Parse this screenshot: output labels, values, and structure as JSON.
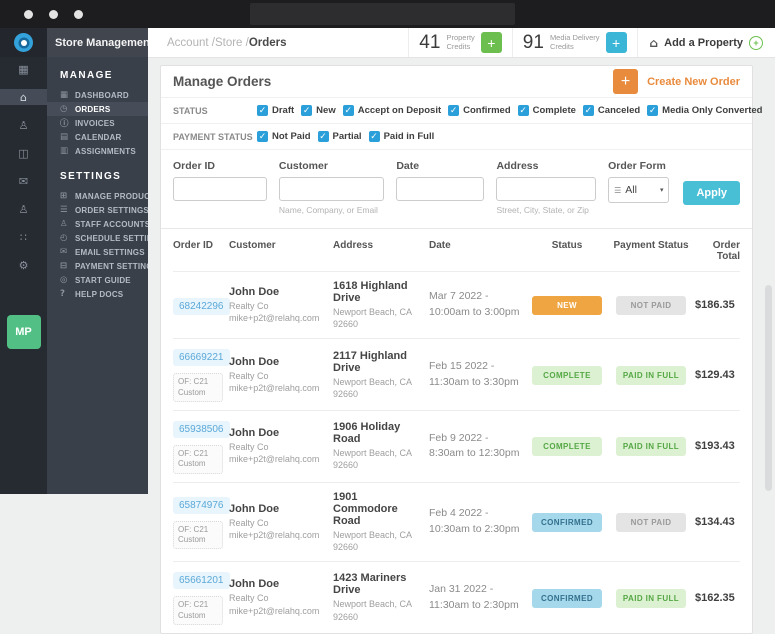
{
  "colors": {
    "accent_orange": "#e98b3d",
    "checkbox_blue": "#2b9fd9",
    "apply_teal": "#49bfd6",
    "credit_green": "#6cbf4e",
    "credit_blue": "#3bb6d6",
    "badge_new_orange": "#efa642",
    "badge_green_bg": "#dcf1d2",
    "badge_green_text": "#55a845",
    "badge_blue_bg": "#a6d8eb",
    "badge_gray_bg": "#e4e4e4",
    "avatar_green": "#52c085",
    "sidebar_dark": "#3a404a"
  },
  "sidebar": {
    "app_title": "Store Management",
    "avatar": "MP",
    "rail": [
      {
        "icon": "grid-icon",
        "glyph": "▦"
      },
      {
        "icon": "home-icon",
        "glyph": "⌂",
        "state": "active"
      },
      {
        "icon": "user-icon",
        "glyph": "♙"
      },
      {
        "icon": "store-icon",
        "glyph": "◫"
      },
      {
        "icon": "mail-icon",
        "glyph": "✉"
      },
      {
        "icon": "staff-icon",
        "glyph": "♙"
      },
      {
        "icon": "apps-icon",
        "glyph": "∷"
      },
      {
        "icon": "gear-icon",
        "glyph": "⚙"
      }
    ],
    "manage": {
      "heading": "MANAGE",
      "items": [
        {
          "label": "DASHBOARD",
          "icon": "dashboard-icon",
          "glyph": "▦"
        },
        {
          "label": "ORDERS",
          "icon": "orders-icon",
          "glyph": "◷",
          "state": "active"
        },
        {
          "label": "INVOICES",
          "icon": "invoices-icon",
          "glyph": "ⓘ"
        },
        {
          "label": "CALENDAR",
          "icon": "calendar-icon",
          "glyph": "▤"
        },
        {
          "label": "ASSIGNMENTS",
          "icon": "assignments-icon",
          "glyph": "▥"
        }
      ]
    },
    "settings": {
      "heading": "SETTINGS",
      "items": [
        {
          "label": "MANAGE PRODUCTS",
          "icon": "manage-products-icon",
          "glyph": "⊞",
          "chevron": "∨"
        },
        {
          "label": "ORDER SETTINGS",
          "icon": "order-settings-icon",
          "glyph": "☰",
          "chevron": "∨"
        },
        {
          "label": "STAFF ACCOUNTS",
          "icon": "staff-accounts-icon",
          "glyph": "♙"
        },
        {
          "label": "SCHEDULE SETTINGS",
          "icon": "schedule-settings-icon",
          "glyph": "◴"
        },
        {
          "label": "EMAIL SETTINGS",
          "icon": "email-settings-icon",
          "glyph": "✉"
        },
        {
          "label": "PAYMENT SETTINGS",
          "icon": "payment-settings-icon",
          "glyph": "⊟"
        },
        {
          "label": "START GUIDE",
          "icon": "start-guide-icon",
          "glyph": "◎"
        },
        {
          "label": "HELP DOCS",
          "icon": "help-docs-icon",
          "glyph": "?"
        }
      ]
    }
  },
  "header": {
    "breadcrumb": {
      "part1": "Account",
      "part2": "Store",
      "part3": "Orders",
      "separator": " /"
    },
    "credits": [
      {
        "value": "41",
        "line1": "Property",
        "line2": "Credits",
        "plus": "+",
        "tone": "green"
      },
      {
        "value": "91",
        "line1": "Media Delivery",
        "line2": "Credits",
        "plus": "+",
        "tone": "blue"
      }
    ],
    "add_property_label": "Add a Property",
    "add_property_plus": "+"
  },
  "panel": {
    "title": "Manage Orders",
    "create_plus": "+",
    "create_label": "Create New Order",
    "status_label": "STATUS",
    "status_options": [
      "Draft",
      "New",
      "Accept on Deposit",
      "Confirmed",
      "Complete",
      "Canceled",
      "Media Only Converted"
    ],
    "payment_label": "PAYMENT STATUS",
    "payment_options": [
      "Not Paid",
      "Partial",
      "Paid in Full"
    ],
    "checkmark": "✓",
    "filters": {
      "order_id_label": "Order ID",
      "customer_label": "Customer",
      "customer_help": "Name, Company, or Email",
      "date_label": "Date",
      "address_label": "Address",
      "address_help": "Street, City, State, or Zip",
      "order_form_label": "Order Form",
      "order_form_value": "All",
      "order_form_caret": "▾",
      "apply_label": "Apply"
    }
  },
  "table": {
    "columns": [
      "Order ID",
      "Customer",
      "Address",
      "Date",
      "Status",
      "Payment Status",
      "Order Total"
    ],
    "rows": [
      {
        "id": "68242296",
        "of": "",
        "name": "John Doe",
        "company": "Realty Co",
        "email": "mike+p2t@relahq.com",
        "street": "1618 Highland Drive",
        "city": "Newport Beach, CA",
        "zip": "92660",
        "date": "Mar 7 2022 - 10:00am to 3:00pm",
        "status": "NEW",
        "status_type": "new",
        "payment": "NOT PAID",
        "payment_type": "not-paid",
        "total": "$186.35"
      },
      {
        "id": "66669221",
        "of": "OF: C21 Custom",
        "name": "John Doe",
        "company": "Realty Co",
        "email": "mike+p2t@relahq.com",
        "street": "2117 Highland Drive",
        "city": "Newport Beach, CA",
        "zip": "92660",
        "date": "Feb 15 2022 - 11:30am to 3:30pm",
        "status": "COMPLETE",
        "status_type": "complete",
        "payment": "PAID IN FULL",
        "payment_type": "paid-in-full",
        "total": "$129.43"
      },
      {
        "id": "65938506",
        "of": "OF: C21 Custom",
        "name": "John Doe",
        "company": "Realty Co",
        "email": "mike+p2t@relahq.com",
        "street": "1906 Holiday Road",
        "city": "Newport Beach, CA",
        "zip": "92660",
        "date": "Feb 9 2022 - 8:30am to 12:30pm",
        "status": "COMPLETE",
        "status_type": "complete",
        "payment": "PAID IN FULL",
        "payment_type": "paid-in-full",
        "total": "$193.43"
      },
      {
        "id": "65874976",
        "of": "OF: C21 Custom",
        "name": "John Doe",
        "company": "Realty Co",
        "email": "mike+p2t@relahq.com",
        "street": "1901 Commodore Road",
        "city": "Newport Beach, CA",
        "zip": "92660",
        "date": "Feb 4 2022 - 10:30am to 2:30pm",
        "status": "CONFIRMED",
        "status_type": "confirmed",
        "payment": "NOT PAID",
        "payment_type": "not-paid",
        "total": "$134.43"
      },
      {
        "id": "65661201",
        "of": "OF: C21 Custom",
        "name": "John Doe",
        "company": "Realty Co",
        "email": "mike+p2t@relahq.com",
        "street": "1423 Mariners Drive",
        "city": "Newport Beach, CA",
        "zip": "92660",
        "date": "Jan 31 2022 - 11:30am to 2:30pm",
        "status": "CONFIRMED",
        "status_type": "confirmed",
        "payment": "PAID IN FULL",
        "payment_type": "paid-in-full",
        "total": "$162.35"
      }
    ]
  }
}
